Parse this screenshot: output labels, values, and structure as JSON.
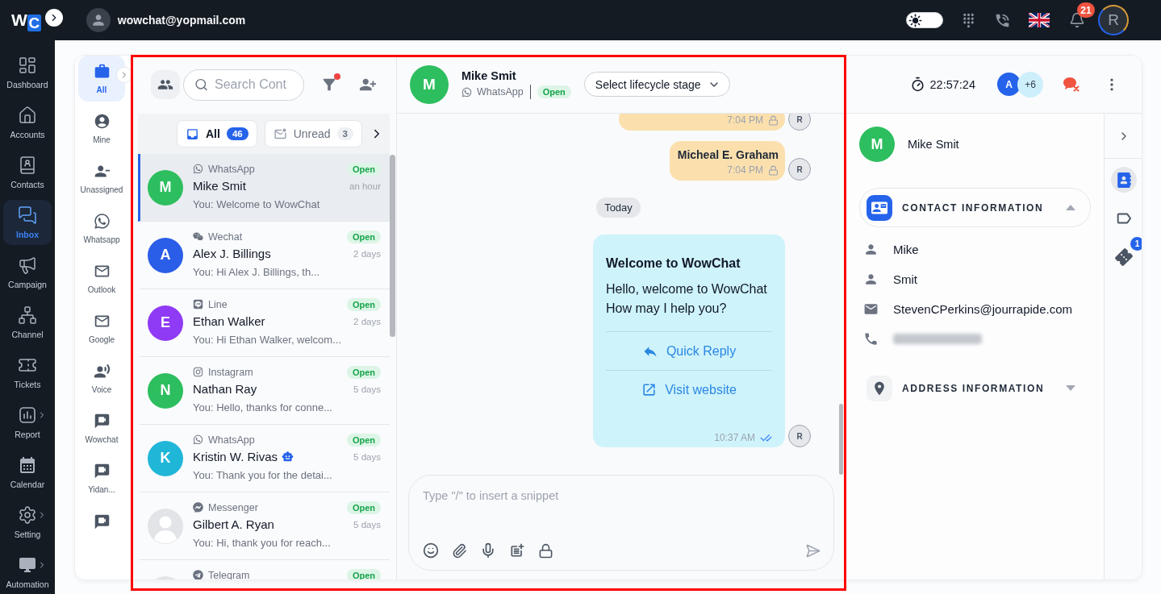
{
  "top_bar": {
    "logo": [
      "W",
      "C"
    ],
    "user_email": "wowchat@yopmail.com",
    "theme_toggle": {
      "on": false
    },
    "notifications": "21",
    "profile_initial": "R"
  },
  "nav": [
    {
      "label": "Dashboard",
      "selected": false,
      "submenu": false
    },
    {
      "label": "Accounts",
      "selected": false,
      "submenu": false
    },
    {
      "label": "Contacts",
      "selected": false,
      "submenu": false
    },
    {
      "label": "Inbox",
      "selected": true,
      "submenu": false
    },
    {
      "label": "Campaign",
      "selected": false,
      "submenu": false
    },
    {
      "label": "Channel",
      "selected": false,
      "submenu": false
    },
    {
      "label": "Tickets",
      "selected": false,
      "submenu": false
    },
    {
      "label": "Report",
      "selected": false,
      "submenu": true
    },
    {
      "label": "Calendar",
      "selected": false,
      "submenu": false
    },
    {
      "label": "Setting",
      "selected": false,
      "submenu": true
    },
    {
      "label": "Automation",
      "selected": false,
      "submenu": true
    }
  ],
  "inbox_filters": [
    {
      "label": "All",
      "selected": true
    },
    {
      "label": "Mine",
      "selected": false
    },
    {
      "label": "Unassigned",
      "selected": false
    },
    {
      "label": "Whatsapp",
      "selected": false
    },
    {
      "label": "Outlook",
      "selected": false
    },
    {
      "label": "Google",
      "selected": false
    },
    {
      "label": "Voice",
      "selected": false
    },
    {
      "label": "Wowchat",
      "selected": false
    },
    {
      "label": "Yidan...",
      "selected": false
    },
    {
      "selected": false
    }
  ],
  "conversation_list": {
    "search": {
      "placeholder": "Search Cont"
    },
    "filter_active": true,
    "tabs": [
      {
        "label": "All",
        "count": "46",
        "selected": true
      },
      {
        "label": "Unread",
        "count": "3",
        "selected": false
      }
    ],
    "conversations": [
      {
        "avatar": {
          "kind": "initial",
          "initial": "M",
          "color": "#2dbe5f"
        },
        "channel": {
          "name": "WhatsApp",
          "kind": "whatsapp"
        },
        "name": "Mike Smit",
        "bot": false,
        "preview": "You: Welcome to WowChat",
        "status": "Open",
        "time": "an hour",
        "selected": true
      },
      {
        "avatar": {
          "kind": "initial",
          "initial": "A",
          "color": "#2a5ee8"
        },
        "channel": {
          "name": "Wechat",
          "kind": "wechat"
        },
        "name": "Alex J. Billings",
        "bot": false,
        "preview": "You: Hi Alex J. Billings, th...",
        "status": "Open",
        "time": "2 days",
        "selected": false
      },
      {
        "avatar": {
          "kind": "initial",
          "initial": "E",
          "color": "#8f3af5"
        },
        "channel": {
          "name": "Line",
          "kind": "line"
        },
        "name": "Ethan Walker",
        "bot": false,
        "preview": "You: Hi Ethan Walker, welcom...",
        "status": "Open",
        "time": "2 days",
        "selected": false
      },
      {
        "avatar": {
          "kind": "initial",
          "initial": "N",
          "color": "#2dbe5f"
        },
        "channel": {
          "name": "Instagram",
          "kind": "instagram"
        },
        "name": "Nathan Ray",
        "bot": false,
        "preview": "You: Hello, thanks for conne...",
        "status": "Open",
        "time": "5 days",
        "selected": false
      },
      {
        "avatar": {
          "kind": "initial",
          "initial": "K",
          "color": "#20b6d8"
        },
        "channel": {
          "name": "WhatsApp",
          "kind": "whatsapp"
        },
        "name": "Kristin W. Rivas",
        "bot": true,
        "preview": "You: Thank you for the detai...",
        "status": "Open",
        "time": "5 days",
        "selected": false
      },
      {
        "avatar": {
          "kind": "silhouette"
        },
        "channel": {
          "name": "Messenger",
          "kind": "messenger"
        },
        "name": "Gilbert A. Ryan",
        "bot": false,
        "preview": "You: Hi, thank you for reach...",
        "status": "Open",
        "time": "5 days",
        "selected": false
      },
      {
        "avatar": {
          "kind": "silhouette"
        },
        "channel": {
          "name": "Telegram",
          "kind": "telegram"
        },
        "status": "Open",
        "selected": false
      }
    ]
  },
  "chat": {
    "contact": {
      "initial": "M",
      "name": "Mike Smit",
      "channel": {
        "name": "WhatsApp",
        "kind": "whatsapp"
      },
      "status": "Open"
    },
    "lifecycle_select": {
      "placeholder": "Select lifecycle stage"
    },
    "timer": "22:57:24",
    "agents": [
      {
        "initial": "A"
      }
    ],
    "more_agents": "+6",
    "messages": [
      {
        "kind": "note",
        "time": "7:04 PM",
        "sender": "R"
      },
      {
        "kind": "note",
        "text": "Micheal E. Graham",
        "time": "7:04 PM",
        "sender": "R"
      },
      {
        "kind": "date",
        "label": "Today"
      },
      {
        "kind": "template",
        "title": "Welcome to WowChat",
        "body": "Hello, welcome to WowChat\nHow may I help you?",
        "buttons": [
          {
            "kind": "reply",
            "label": "Quick Reply"
          },
          {
            "kind": "link",
            "label": "Visit website"
          }
        ],
        "time": "10:37 AM",
        "read": true,
        "sender": "R"
      }
    ],
    "composer": {
      "placeholder": "Type \"/\" to insert a snippet"
    }
  },
  "contact_panel": {
    "initial": "M",
    "name": "Mike Smit",
    "sections": [
      {
        "kind": "contact",
        "title": "CONTACT INFORMATION",
        "expanded": true,
        "fields": [
          {
            "kind": "first_name",
            "value": "Mike"
          },
          {
            "kind": "last_name",
            "value": "Smit"
          },
          {
            "kind": "email",
            "value": "StevenCPerkins@jourrapide.com"
          },
          {
            "kind": "phone",
            "redacted": true
          }
        ]
      },
      {
        "kind": "address",
        "title": "ADDRESS INFORMATION",
        "expanded": false
      }
    ]
  },
  "right_rail": [
    {
      "selected": true
    },
    {
      "selected": false
    },
    {
      "selected": false,
      "badge": "1"
    }
  ]
}
